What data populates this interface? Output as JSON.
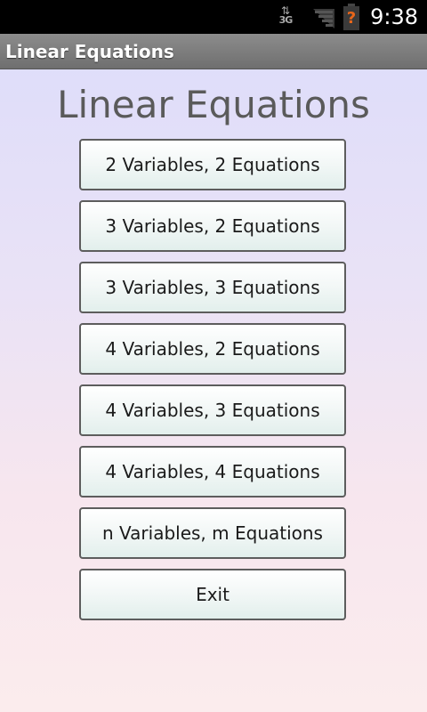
{
  "status_bar": {
    "network_label": "3G",
    "time": "9:38",
    "icons": [
      "data-transfer-icon",
      "signal-icon",
      "battery-warning-icon"
    ]
  },
  "title_bar": {
    "title": "Linear Equations"
  },
  "main": {
    "heading": "Linear Equations",
    "buttons": [
      {
        "label": "2 Variables, 2 Equations"
      },
      {
        "label": "3 Variables, 2 Equations"
      },
      {
        "label": "3 Variables, 3 Equations"
      },
      {
        "label": "4 Variables, 2 Equations"
      },
      {
        "label": "4 Variables, 3 Equations"
      },
      {
        "label": "4 Variables, 4 Equations"
      },
      {
        "label": "n Variables, m Equations"
      },
      {
        "label": "Exit"
      }
    ]
  },
  "colors": {
    "background_top": "#dcdcfb",
    "background_bottom": "#fbeced",
    "title_bar": "#7a7a7a",
    "battery_warning": "#e8661a"
  }
}
